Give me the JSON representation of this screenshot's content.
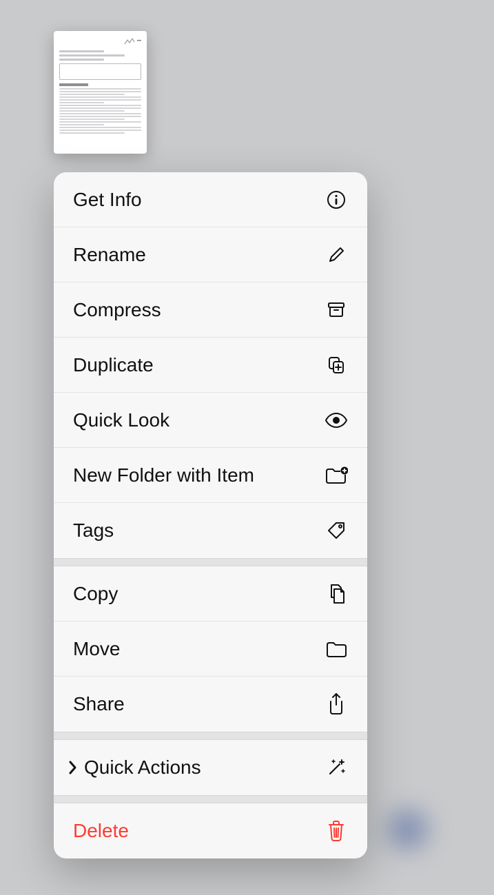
{
  "preview": {
    "type": "document-thumbnail"
  },
  "menu": {
    "sections": [
      {
        "items": [
          {
            "id": "get-info",
            "label": "Get Info",
            "icon": "info-icon"
          },
          {
            "id": "rename",
            "label": "Rename",
            "icon": "pencil-icon"
          },
          {
            "id": "compress",
            "label": "Compress",
            "icon": "archivebox-icon"
          },
          {
            "id": "duplicate",
            "label": "Duplicate",
            "icon": "duplicate-icon"
          },
          {
            "id": "quick-look",
            "label": "Quick Look",
            "icon": "eye-icon"
          },
          {
            "id": "new-folder",
            "label": "New Folder with Item",
            "icon": "folder-plus-icon"
          },
          {
            "id": "tags",
            "label": "Tags",
            "icon": "tag-icon"
          }
        ]
      },
      {
        "items": [
          {
            "id": "copy",
            "label": "Copy",
            "icon": "doc-on-doc-icon"
          },
          {
            "id": "move",
            "label": "Move",
            "icon": "folder-icon"
          },
          {
            "id": "share",
            "label": "Share",
            "icon": "share-icon"
          }
        ]
      },
      {
        "items": [
          {
            "id": "quick-actions",
            "label": "Quick Actions",
            "icon": "wand-icon",
            "hasChevron": true
          }
        ]
      },
      {
        "items": [
          {
            "id": "delete",
            "label": "Delete",
            "icon": "trash-icon",
            "destructive": true
          }
        ]
      }
    ]
  }
}
